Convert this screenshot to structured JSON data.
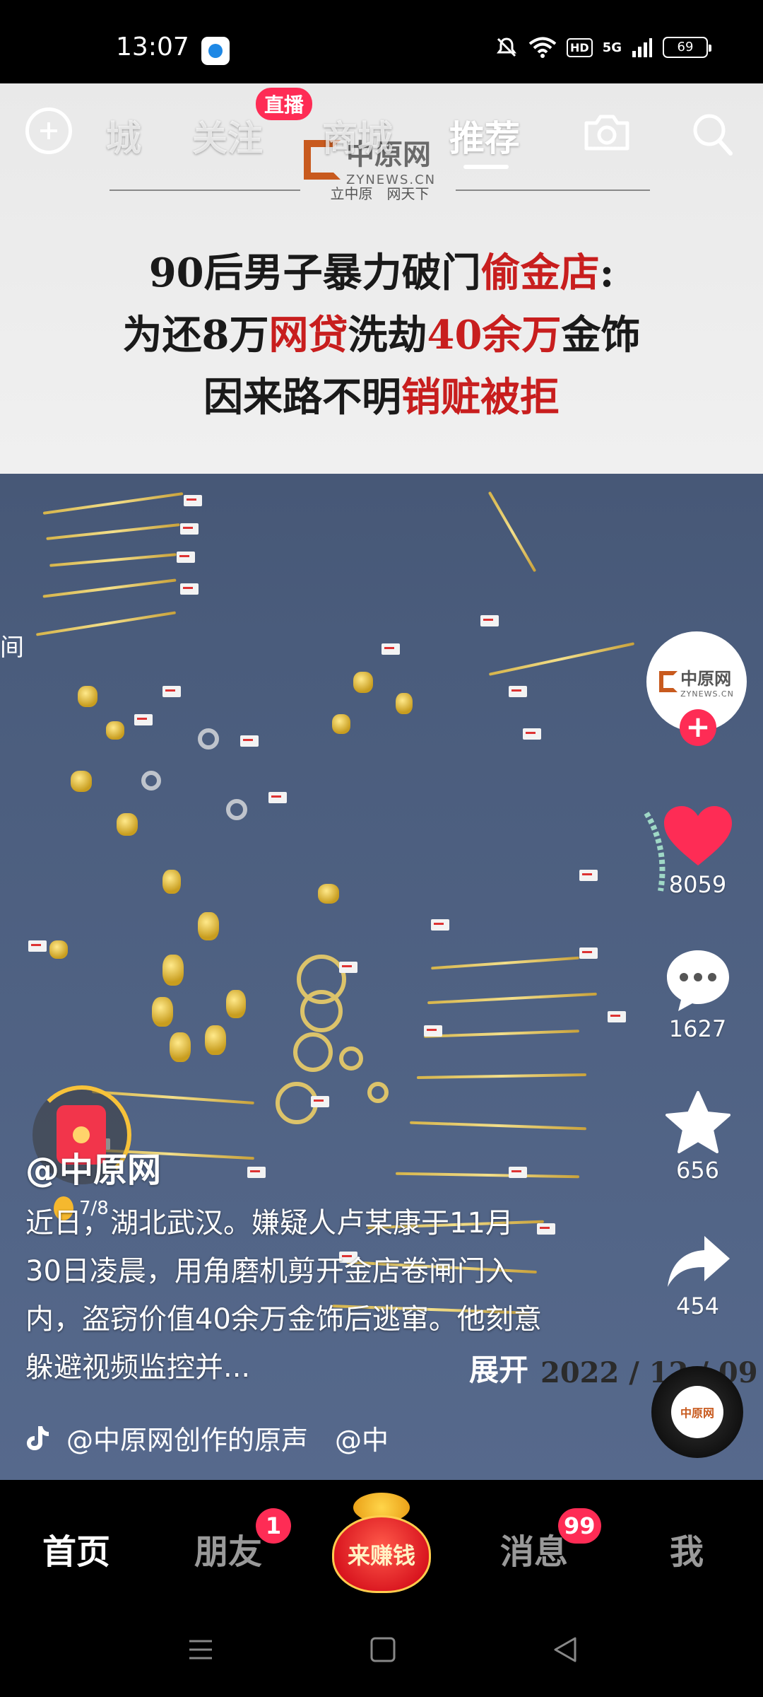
{
  "status_bar": {
    "time": "13:07",
    "hd_label": "HD",
    "network_label": "5G",
    "battery": "69"
  },
  "top_nav": {
    "tabs": [
      {
        "label": "城"
      },
      {
        "label": "关注"
      },
      {
        "label": "商城"
      },
      {
        "label": "推荐"
      }
    ],
    "active_tab": "推荐",
    "live_badge": "直播",
    "icons": [
      "plus-circle-icon",
      "camera-icon",
      "search-icon"
    ]
  },
  "video": {
    "source_logo": {
      "name": "中原网",
      "en": "ZYNEWS.CN",
      "slogan": "立中原　网天下"
    },
    "headline": {
      "line1_a": "90后男子暴力破门",
      "line1_b": "偷金店",
      "line1_c": ":",
      "line2_a": "为还8万",
      "line2_b": "网贷",
      "line2_c": "洗劫",
      "line2_d": "40余万",
      "line2_e": "金饰",
      "line3_a": "因来路不明",
      "line3_b": "销赃被拒"
    },
    "date_stamp": "2022 / 12 / 09",
    "left_edge_text": "间",
    "accent_red": "#c81e1e"
  },
  "actions": {
    "avatar_name": "中原网",
    "avatar_en": "ZYNEWS.CN",
    "follow_label": "+",
    "likes": "8059",
    "comments": "1627",
    "favorites": "656",
    "shares": "454",
    "music_disc_label": "中原网"
  },
  "post": {
    "author": "@中原网",
    "redpack_progress": "7/8",
    "caption": "近日，湖北武汉。嫌疑人卢某康于11月30日凌晨，用角磨机剪开金店卷闸门入内，盗窃价值40余万金饰后逃窜。他刻意躲避视频监控并...",
    "expand_label": "展开",
    "music": "@中原网创作的原声　@中"
  },
  "tab_bar": {
    "home": "首页",
    "friends": "朋友",
    "friends_badge": "1",
    "earn": "来赚钱",
    "messages": "消息",
    "messages_badge": "99",
    "me": "我"
  },
  "colors": {
    "brand_red": "#fe2c55",
    "like_red": "#fe2c55",
    "background": "#000000"
  }
}
